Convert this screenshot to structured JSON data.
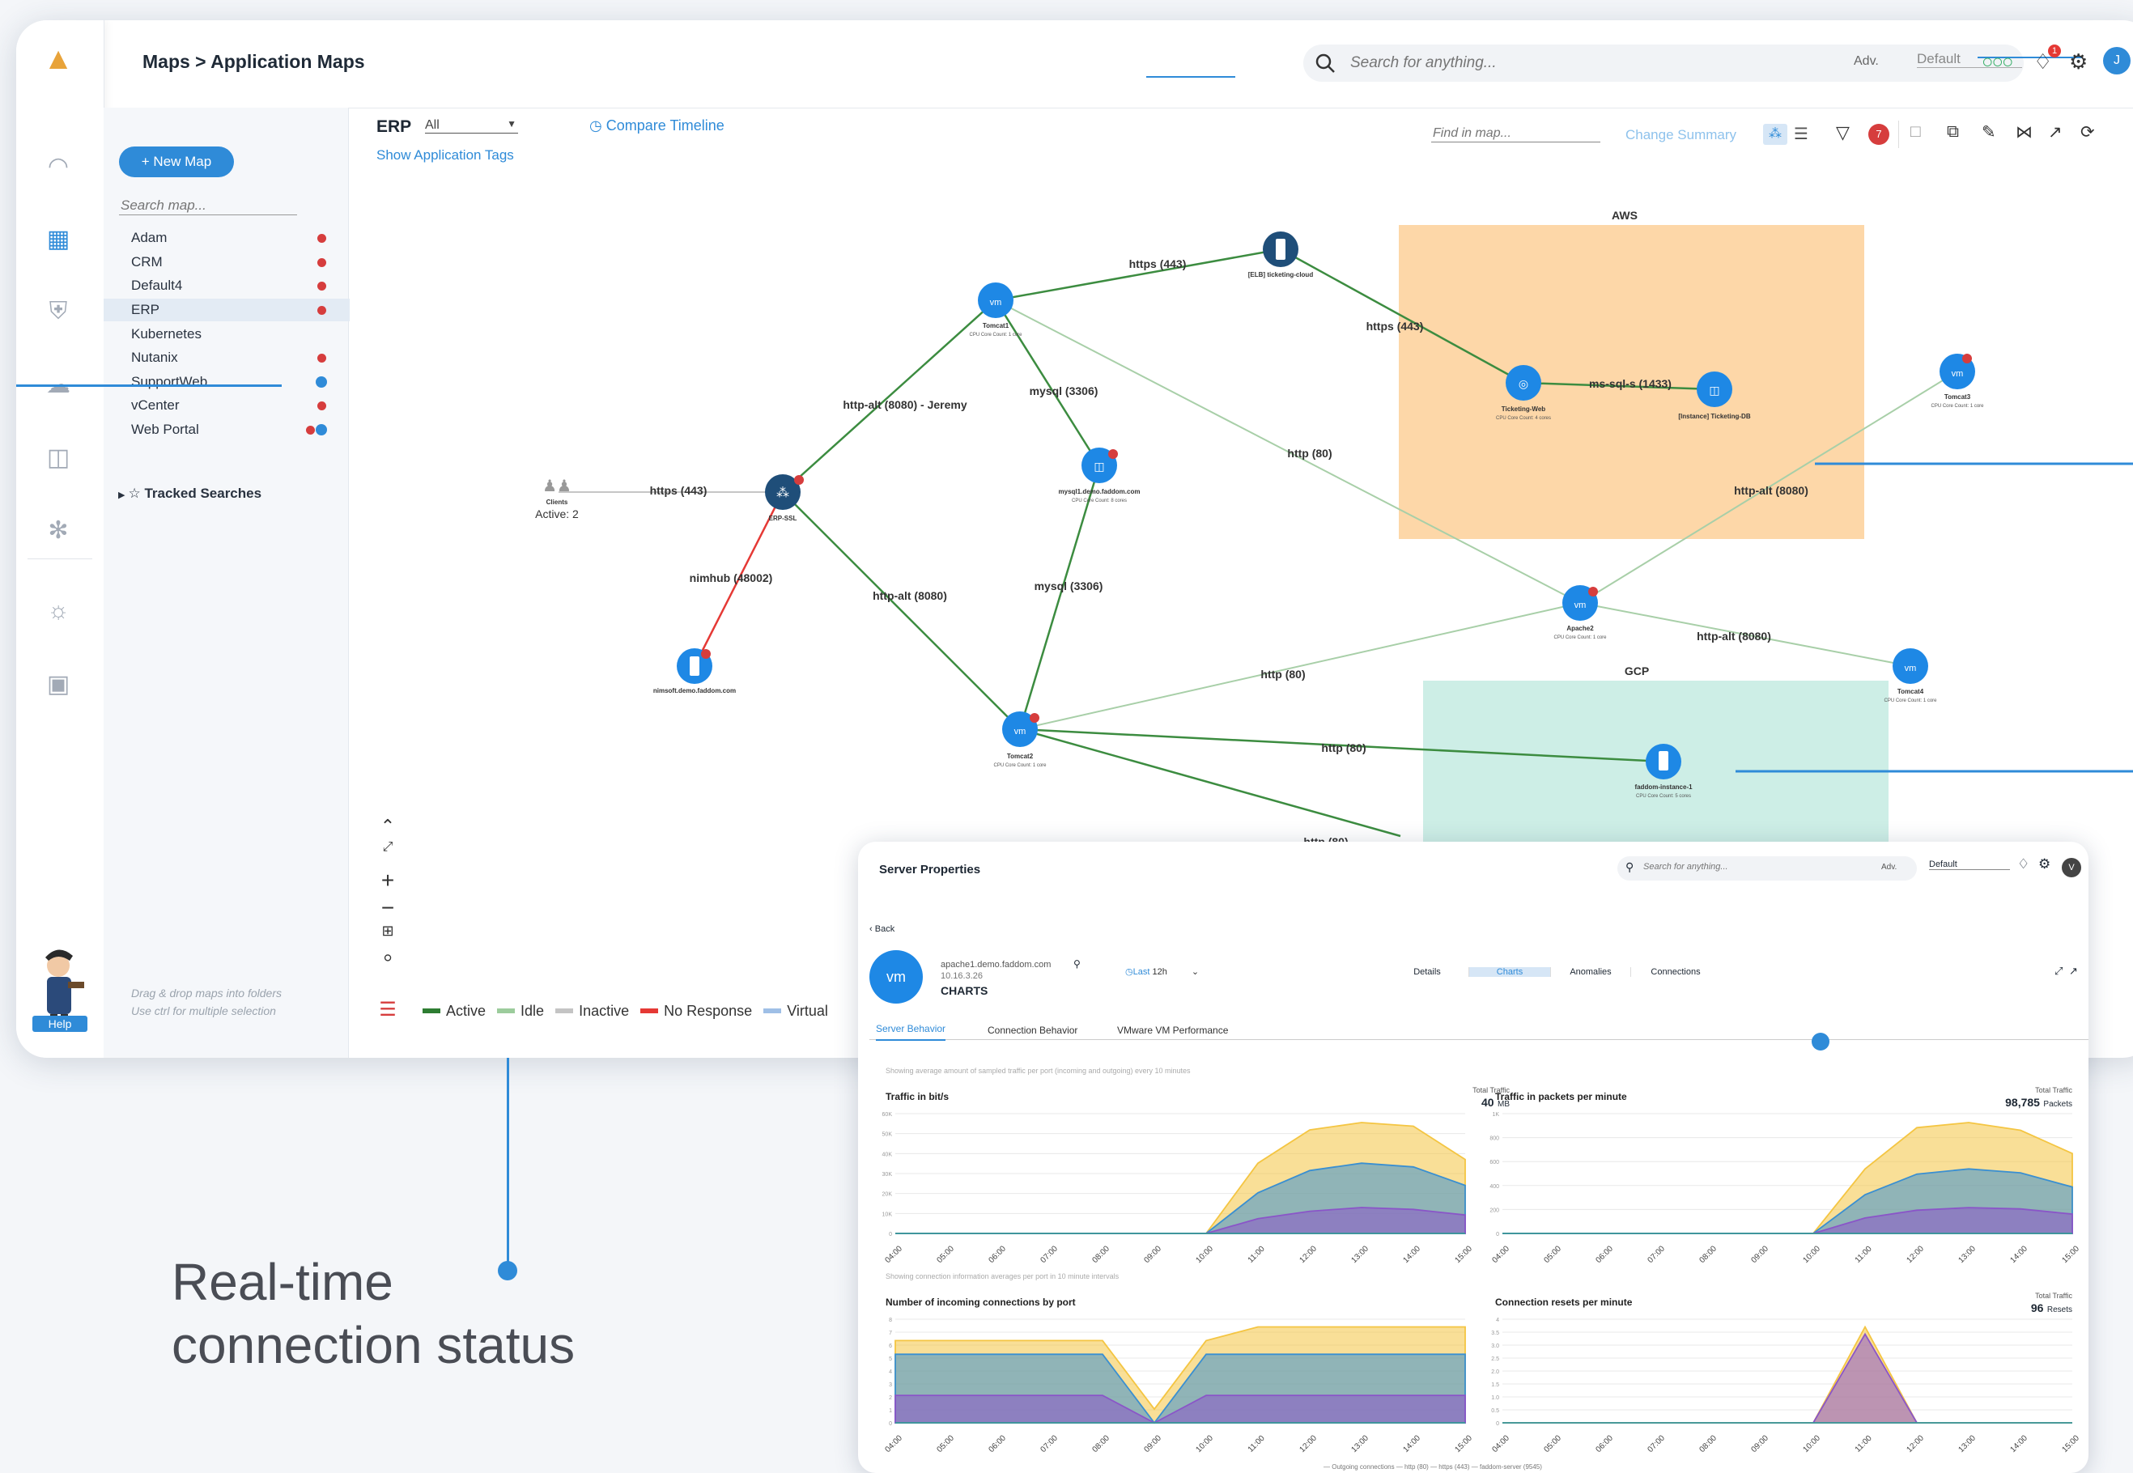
{
  "app": {
    "breadcrumb": "Maps > Application Maps",
    "search_placeholder": "Search for anything...",
    "adv_label": "Adv.",
    "default_label": "Default",
    "notification_count": "1",
    "avatar_letter": "J"
  },
  "map_panel": {
    "new_map_label": "+ New Map",
    "search_placeholder": "Search map...",
    "maps": [
      "Adam",
      "CRM",
      "Default4",
      "ERP",
      "Kubernetes",
      "Nutanix",
      "SupportWeb",
      "vCenter",
      "Web Portal"
    ],
    "selected": "ERP",
    "tracked_searches": "Tracked Searches",
    "hint_line1": "Drag & drop maps into folders",
    "hint_line2": "Use ctrl for multiple selection",
    "help_label": "Help"
  },
  "toolbar": {
    "map_name": "ERP",
    "filter_value": "All",
    "compare_timeline": "Compare Timeline",
    "show_tags": "Show Application Tags",
    "find_placeholder": "Find in map...",
    "change_summary": "Change Summary",
    "filter_count": "7"
  },
  "map": {
    "group_aws": "AWS",
    "group_gcp": "GCP",
    "clients_label": "Clients",
    "clients_active": "Active: 2",
    "nodes": {
      "elb": "[ELB] ticketing-cloud",
      "tomcat1": "Tomcat1",
      "ticketing_web": "Ticketing-Web",
      "ticketing_db": "[Instance] Ticketing-DB",
      "tomcat3": "Tomcat3",
      "mysql1": "mysql1.demo.faddom.com",
      "erp_ssl": "ERP-SSL",
      "apache2": "Apache2",
      "tomcat4": "Tomcat4",
      "nimsoft": "nimsoft.demo.faddom.com",
      "tomcat2": "Tomcat2",
      "faddom_instance": "faddom-instance-1"
    },
    "node_sub": {
      "cpu1": "CPU Core Count: 1 core",
      "cpu4": "CPU Core Count: 4 cores",
      "cpu8": "CPU Core Count: 8 cores",
      "cpu5": "CPU Core Count: 5 cores"
    },
    "edges": {
      "https443": "https (443)",
      "mssql": "ms-sql-s (1433)",
      "httpalt_jeremy": "http-alt (8080) - Jeremy",
      "mysql3306": "mysql (3306)",
      "http80": "http (80)",
      "httpalt8080": "http-alt (8080)",
      "nimhub": "nimhub (48002)"
    }
  },
  "legend": [
    {
      "label": "Active",
      "color": "#2e7d32"
    },
    {
      "label": "Idle",
      "color": "#9ccc9c"
    },
    {
      "label": "Inactive",
      "color": "#c4c4c4"
    },
    {
      "label": "No Response",
      "color": "#e53935"
    },
    {
      "label": "Virtual",
      "color": "#9fbfe6"
    }
  ],
  "server_props": {
    "title": "Server Properties",
    "search_placeholder": "Search for anything...",
    "adv_label": "Adv.",
    "default_label": "Default",
    "avatar_letter": "V",
    "back": "Back",
    "hostname": "apache1.demo.faddom.com",
    "ip": "10.16.3.26",
    "section": "CHARTS",
    "time_label": "Last",
    "time_value": "12h",
    "tabs": [
      "Details",
      "Charts",
      "Anomalies",
      "Connections"
    ],
    "subtabs": [
      "Server Behavior",
      "Connection Behavior",
      "VMware VM Performance"
    ],
    "note1": "Showing average amount of sampled traffic per port (incoming and outgoing) every 10 minutes",
    "note2": "Showing connection information averages per port in 10 minute intervals",
    "total_traffic_label": "Total Traffic",
    "legend_bottom": "— Outgoing connections — http (80) — https (443) — faddom-server (9545)"
  },
  "chart_data": [
    {
      "type": "area",
      "title": "Traffic in bit/s",
      "total": "40",
      "total_unit": "MB",
      "x": [
        "04:00",
        "05:00",
        "06:00",
        "07:00",
        "08:00",
        "09:00",
        "10:00",
        "11:00",
        "12:00",
        "13:00",
        "14:00",
        "15:00"
      ],
      "y_ticks": [
        "0",
        "10K",
        "20K",
        "30K",
        "40K",
        "50K",
        "60K"
      ],
      "series": [
        {
          "color": "#f4c542",
          "values": [
            0,
            0,
            0,
            0,
            0,
            0,
            0,
            38,
            56,
            60,
            58,
            40
          ]
        },
        {
          "color": "#3a8fd1",
          "values": [
            0,
            0,
            0,
            0,
            0,
            0,
            0,
            22,
            34,
            38,
            36,
            26
          ]
        },
        {
          "color": "#8a55c8",
          "values": [
            0,
            0,
            0,
            0,
            0,
            0,
            0,
            8,
            12,
            14,
            13,
            10
          ]
        }
      ]
    },
    {
      "type": "area",
      "title": "Traffic in packets per minute",
      "total": "98,785",
      "total_unit": "Packets",
      "x": [
        "04:00",
        "05:00",
        "06:00",
        "07:00",
        "08:00",
        "09:00",
        "10:00",
        "11:00",
        "12:00",
        "13:00",
        "14:00",
        "15:00"
      ],
      "y_ticks": [
        "0",
        "200",
        "400",
        "600",
        "800",
        "1K"
      ],
      "series": [
        {
          "color": "#f4c542",
          "values": [
            0,
            0,
            0,
            0,
            0,
            0,
            0,
            500,
            820,
            860,
            800,
            620
          ]
        },
        {
          "color": "#3a8fd1",
          "values": [
            0,
            0,
            0,
            0,
            0,
            0,
            0,
            300,
            460,
            500,
            470,
            360
          ]
        },
        {
          "color": "#8a55c8",
          "values": [
            0,
            0,
            0,
            0,
            0,
            0,
            0,
            120,
            180,
            200,
            190,
            150
          ]
        }
      ]
    },
    {
      "type": "area",
      "title": "Number of incoming connections by port",
      "x": [
        "04:00",
        "05:00",
        "06:00",
        "07:00",
        "08:00",
        "09:00",
        "10:00",
        "11:00",
        "12:00",
        "13:00",
        "14:00",
        "15:00"
      ],
      "y_ticks": [
        "0",
        "1",
        "2",
        "3",
        "4",
        "5",
        "6",
        "7",
        "8"
      ],
      "series": [
        {
          "color": "#f4c542",
          "values": [
            6,
            6,
            6,
            6,
            6,
            1,
            6,
            7,
            7,
            7,
            7,
            7
          ]
        },
        {
          "color": "#3a8fd1",
          "values": [
            5,
            5,
            5,
            5,
            5,
            0,
            5,
            5,
            5,
            5,
            5,
            5
          ]
        },
        {
          "color": "#8a55c8",
          "values": [
            2,
            2,
            2,
            2,
            2,
            0,
            2,
            2,
            2,
            2,
            2,
            2
          ]
        }
      ]
    },
    {
      "type": "area",
      "title": "Connection resets per minute",
      "total": "96",
      "total_unit": "Resets",
      "x": [
        "04:00",
        "05:00",
        "06:00",
        "07:00",
        "08:00",
        "09:00",
        "10:00",
        "11:00",
        "12:00",
        "13:00",
        "14:00",
        "15:00"
      ],
      "y_ticks": [
        "0",
        "0.5",
        "1.0",
        "1.5",
        "2.0",
        "2.5",
        "3.0",
        "3.5",
        "4"
      ],
      "series": [
        {
          "color": "#f4c542",
          "values": [
            0,
            0,
            0,
            0,
            0,
            0,
            0,
            4,
            0,
            0,
            0,
            0
          ]
        },
        {
          "color": "#8a55c8",
          "values": [
            0,
            0,
            0,
            0,
            0,
            0,
            0,
            3.7,
            0,
            0,
            0,
            0
          ]
        }
      ]
    }
  ],
  "callout": {
    "line1": "Real-time",
    "line2": "connection status"
  }
}
